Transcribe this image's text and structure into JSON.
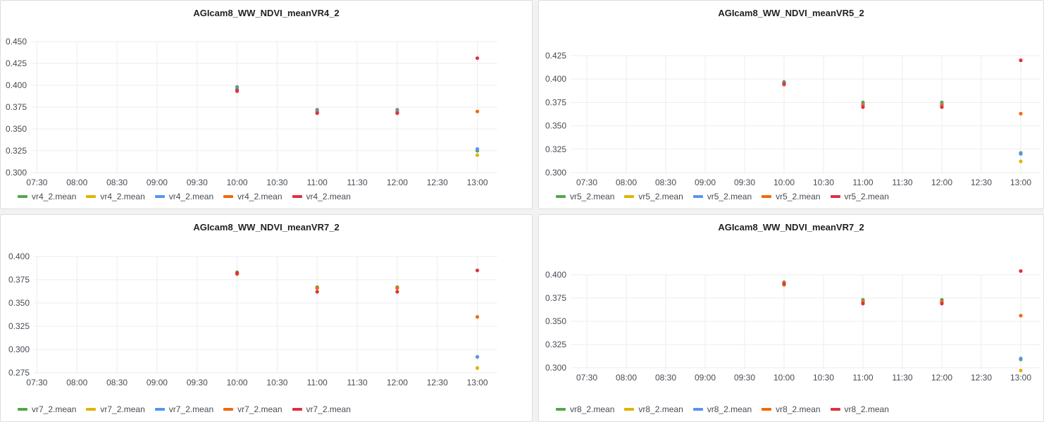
{
  "colors": {
    "green": "#56a64b",
    "yellow": "#e0b400",
    "blue": "#5794f2",
    "orange": "#f2690d",
    "red": "#e02f44",
    "grid": "#ededee",
    "axis_text": "#464c54"
  },
  "chart_data": [
    {
      "type": "scatter",
      "title": "AGIcam8_WW_NDVI_meanVR4_2",
      "x_ticks": [
        "07:30",
        "08:00",
        "08:30",
        "09:00",
        "09:30",
        "10:00",
        "10:30",
        "11:00",
        "11:30",
        "12:00",
        "12:30",
        "13:00"
      ],
      "y_ticks": [
        "0.450",
        "0.425",
        "0.400",
        "0.375",
        "0.350",
        "0.325",
        "0.300"
      ],
      "ylim": [
        0.3,
        0.45
      ],
      "grid": true,
      "legend_position": "bottom-left",
      "series": [
        {
          "name": "vr4_2.mean",
          "color": "green",
          "points": [
            [
              "10:00",
              0.398
            ],
            [
              "11:00",
              0.372
            ],
            [
              "12:00",
              0.372
            ],
            [
              "13:00",
              0.325
            ]
          ]
        },
        {
          "name": "vr4_2.mean",
          "color": "yellow",
          "points": [
            [
              "10:00",
              0.395
            ],
            [
              "11:00",
              0.37
            ],
            [
              "12:00",
              0.37
            ],
            [
              "13:00",
              0.32
            ]
          ]
        },
        {
          "name": "vr4_2.mean",
          "color": "blue",
          "points": [
            [
              "10:00",
              0.396
            ],
            [
              "11:00",
              0.371
            ],
            [
              "12:00",
              0.371
            ],
            [
              "13:00",
              0.327
            ]
          ]
        },
        {
          "name": "vr4_2.mean",
          "color": "orange",
          "points": [
            [
              "10:00",
              0.393
            ],
            [
              "11:00",
              0.369
            ],
            [
              "12:00",
              0.369
            ],
            [
              "13:00",
              0.37
            ]
          ]
        },
        {
          "name": "vr4_2.mean",
          "color": "red",
          "points": [
            [
              "10:00",
              0.394
            ],
            [
              "11:00",
              0.368
            ],
            [
              "12:00",
              0.368
            ],
            [
              "13:00",
              0.431
            ]
          ]
        }
      ]
    },
    {
      "type": "scatter",
      "title": "AGIcam8_WW_NDVI_meanVR5_2",
      "x_ticks": [
        "07:30",
        "08:00",
        "08:30",
        "09:00",
        "09:30",
        "10:00",
        "10:30",
        "11:00",
        "11:30",
        "12:00",
        "12:30",
        "13:00"
      ],
      "y_ticks": [
        "0.425",
        "0.400",
        "0.375",
        "0.350",
        "0.325",
        "0.300"
      ],
      "ylim": [
        0.3,
        0.425
      ],
      "grid": true,
      "legend_position": "bottom-left",
      "series": [
        {
          "name": "vr5_2.mean",
          "color": "green",
          "points": [
            [
              "10:00",
              0.397
            ],
            [
              "11:00",
              0.375
            ],
            [
              "12:00",
              0.375
            ],
            [
              "13:00",
              0.321
            ]
          ]
        },
        {
          "name": "vr5_2.mean",
          "color": "yellow",
          "points": [
            [
              "10:00",
              0.396
            ],
            [
              "11:00",
              0.373
            ],
            [
              "12:00",
              0.373
            ],
            [
              "13:00",
              0.312
            ]
          ]
        },
        {
          "name": "vr5_2.mean",
          "color": "blue",
          "points": [
            [
              "10:00",
              0.396
            ],
            [
              "11:00",
              0.373
            ],
            [
              "12:00",
              0.373
            ],
            [
              "13:00",
              0.32
            ]
          ]
        },
        {
          "name": "vr5_2.mean",
          "color": "orange",
          "points": [
            [
              "10:00",
              0.394
            ],
            [
              "11:00",
              0.372
            ],
            [
              "12:00",
              0.372
            ],
            [
              "13:00",
              0.363
            ]
          ]
        },
        {
          "name": "vr5_2.mean",
          "color": "red",
          "points": [
            [
              "10:00",
              0.395
            ],
            [
              "11:00",
              0.37
            ],
            [
              "12:00",
              0.37
            ],
            [
              "13:00",
              0.42
            ]
          ]
        }
      ]
    },
    {
      "type": "scatter",
      "title": "AGIcam8_WW_NDVI_meanVR7_2",
      "x_ticks": [
        "07:30",
        "08:00",
        "08:30",
        "09:00",
        "09:30",
        "10:00",
        "10:30",
        "11:00",
        "11:30",
        "12:00",
        "12:30",
        "13:00"
      ],
      "y_ticks": [
        "0.400",
        "0.375",
        "0.350",
        "0.325",
        "0.300",
        "0.275"
      ],
      "ylim": [
        0.275,
        0.4
      ],
      "grid": true,
      "legend_position": "bottom-left",
      "series": [
        {
          "name": "vr7_2.mean",
          "color": "green",
          "points": [
            [
              "10:00",
              0.383
            ],
            [
              "11:00",
              0.367
            ],
            [
              "12:00",
              0.367
            ],
            [
              "13:00",
              0.292
            ]
          ]
        },
        {
          "name": "vr7_2.mean",
          "color": "yellow",
          "points": [
            [
              "10:00",
              0.382
            ],
            [
              "11:00",
              0.366
            ],
            [
              "12:00",
              0.366
            ],
            [
              "13:00",
              0.28
            ]
          ]
        },
        {
          "name": "vr7_2.mean",
          "color": "blue",
          "points": [
            [
              "10:00",
              0.382
            ],
            [
              "11:00",
              0.366
            ],
            [
              "12:00",
              0.366
            ],
            [
              "13:00",
              0.292
            ]
          ]
        },
        {
          "name": "vr7_2.mean",
          "color": "orange",
          "points": [
            [
              "10:00",
              0.381
            ],
            [
              "11:00",
              0.366
            ],
            [
              "12:00",
              0.366
            ],
            [
              "13:00",
              0.335
            ]
          ]
        },
        {
          "name": "vr7_2.mean",
          "color": "red",
          "points": [
            [
              "10:00",
              0.382
            ],
            [
              "11:00",
              0.362
            ],
            [
              "12:00",
              0.362
            ],
            [
              "13:00",
              0.385
            ]
          ]
        }
      ]
    },
    {
      "type": "scatter",
      "title": "AGIcam8_WW_NDVI_meanVR7_2",
      "x_ticks": [
        "07:30",
        "08:00",
        "08:30",
        "09:00",
        "09:30",
        "10:00",
        "10:30",
        "11:00",
        "11:30",
        "12:00",
        "12:30",
        "13:00"
      ],
      "y_ticks": [
        "0.400",
        "0.375",
        "0.350",
        "0.325",
        "0.300"
      ],
      "ylim": [
        0.3,
        0.4
      ],
      "grid": true,
      "legend_position": "bottom-left",
      "series": [
        {
          "name": "vr8_2.mean",
          "color": "green",
          "points": [
            [
              "10:00",
              0.392
            ],
            [
              "11:00",
              0.373
            ],
            [
              "12:00",
              0.373
            ],
            [
              "13:00",
              0.309
            ]
          ]
        },
        {
          "name": "vr8_2.mean",
          "color": "yellow",
          "points": [
            [
              "10:00",
              0.389
            ],
            [
              "11:00",
              0.371
            ],
            [
              "12:00",
              0.371
            ],
            [
              "13:00",
              0.297
            ]
          ]
        },
        {
          "name": "vr8_2.mean",
          "color": "blue",
          "points": [
            [
              "10:00",
              0.391
            ],
            [
              "11:00",
              0.371
            ],
            [
              "12:00",
              0.371
            ],
            [
              "13:00",
              0.31
            ]
          ]
        },
        {
          "name": "vr8_2.mean",
          "color": "orange",
          "points": [
            [
              "10:00",
              0.391
            ],
            [
              "11:00",
              0.371
            ],
            [
              "12:00",
              0.371
            ],
            [
              "13:00",
              0.356
            ]
          ]
        },
        {
          "name": "vr8_2.mean",
          "color": "red",
          "points": [
            [
              "10:00",
              0.39
            ],
            [
              "11:00",
              0.369
            ],
            [
              "12:00",
              0.369
            ],
            [
              "13:00",
              0.404
            ]
          ]
        }
      ]
    }
  ]
}
